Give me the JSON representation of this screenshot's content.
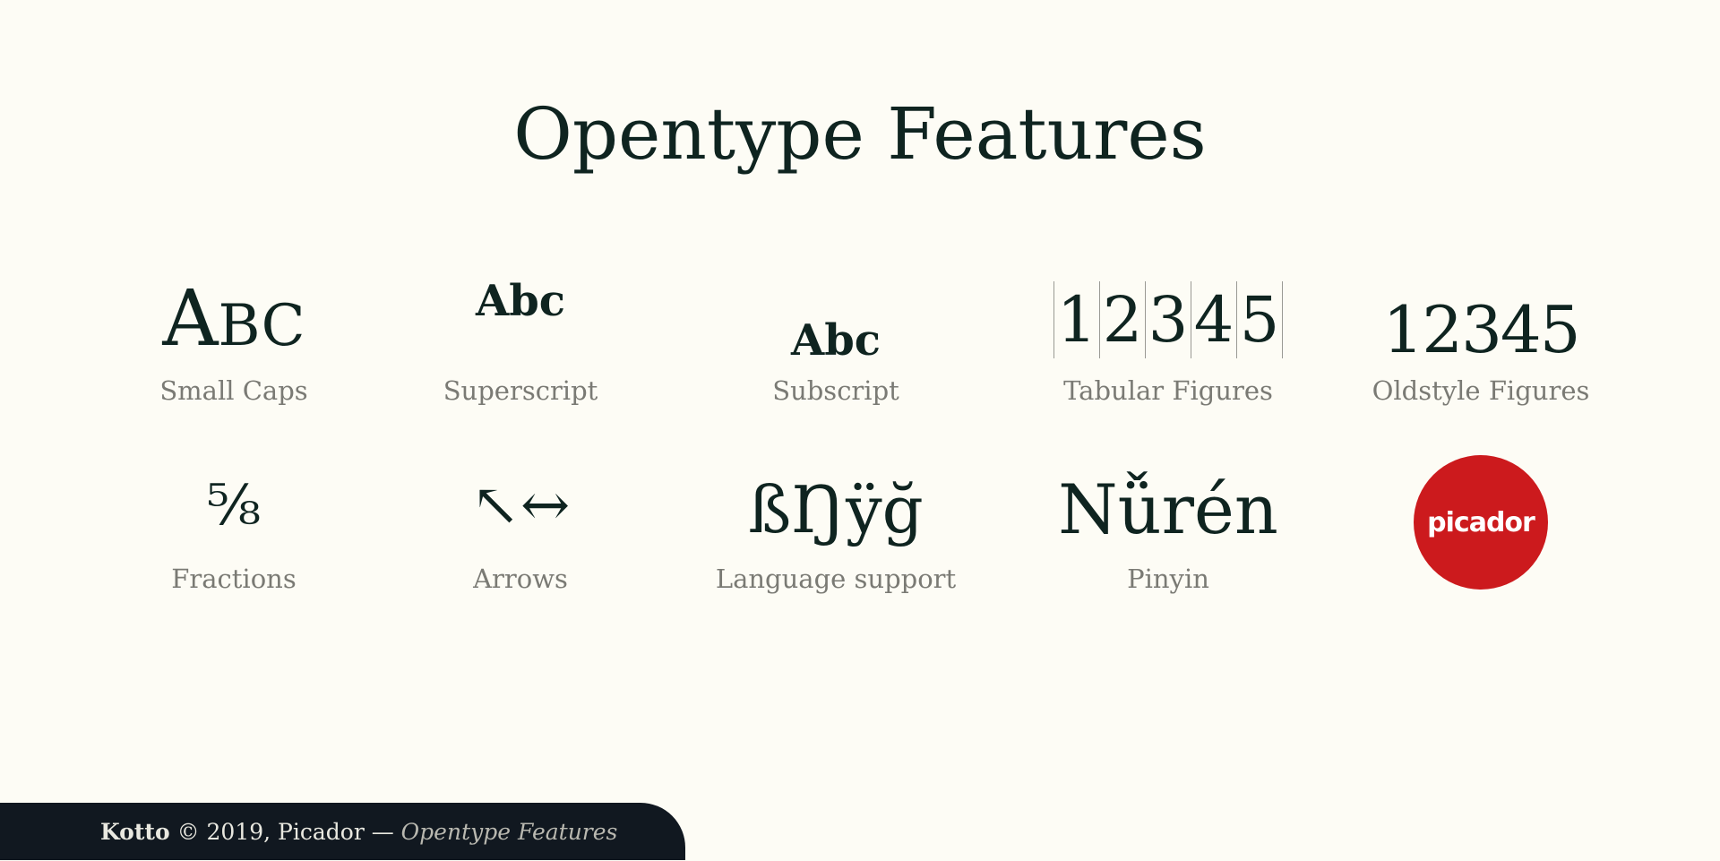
{
  "page": {
    "title": "Opentype Features"
  },
  "features_row1": [
    {
      "sample_cap": "A",
      "sample_small": "BC",
      "label": "Small Caps"
    },
    {
      "sample": "Abc",
      "label": "Superscript"
    },
    {
      "sample": "Abc",
      "label": "Subscript"
    },
    {
      "digits": [
        "1",
        "2",
        "3",
        "4",
        "5"
      ],
      "label": "Tabular Figures"
    },
    {
      "sample": "12345",
      "label": "Oldstyle Figures"
    }
  ],
  "features_row2": [
    {
      "sample": "⁵⁄₈",
      "label": "Fractions"
    },
    {
      "sample": "↖↔",
      "label": "Arrows"
    },
    {
      "sample": "ßŊÿğ",
      "label": "Language support"
    },
    {
      "sample": "Nǚrén",
      "label": "Pinyin"
    }
  ],
  "logo": {
    "text": "picador",
    "color": "#cc1a1d"
  },
  "footer": {
    "brand": "Kotto",
    "copyright": " © 2019, Picador — ",
    "feature": "Opentype Features"
  },
  "colors": {
    "background": "#fdfcf5",
    "ink": "#0f2420",
    "caption": "#7a7a74",
    "footer_bg": "#111820"
  }
}
